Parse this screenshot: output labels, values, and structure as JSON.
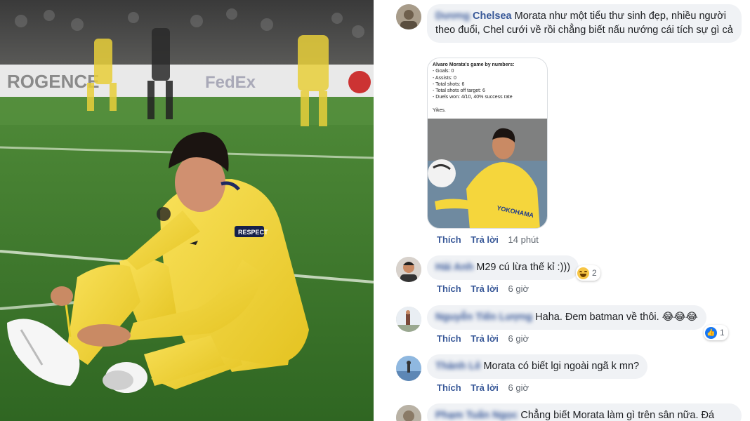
{
  "colors": {
    "link": "#385898",
    "bubble": "#f0f2f5",
    "meta": "#606770",
    "pitch": "#3f7a2c",
    "kit": "#f5d63c"
  },
  "photo": {
    "board_texts": [
      "ROGENCE",
      "FedEx"
    ],
    "armband": "RESPECT"
  },
  "comments": [
    {
      "author_blurred": "Dương",
      "author": "Chelsea",
      "text": "Morata như một tiểu thư sinh đẹp, nhiều người theo đuổi, Chel cưới về rồi chẳng biết nấu nướng cái tích sự gì cả",
      "attachment": {
        "lines": [
          "Alvaro Morata's game by numbers:",
          "- Goals: 0",
          "- Assists: 0",
          "- Total shots: 6",
          "- Total shots off target: 6",
          "- Duels won: 4/10, 40% success rate",
          "",
          "Yikes."
        ],
        "shirt_sponsor": "YOKOHAMA"
      },
      "like": "Thích",
      "reply": "Trả lời",
      "time": "14 phút"
    },
    {
      "author_blurred": "Hải Anh",
      "text": "M29 cú lừa thế kỉ :)))",
      "reaction_icon": "haha-icon",
      "reaction_count": "2",
      "like": "Thích",
      "reply": "Trả lời",
      "time": "6 giờ"
    },
    {
      "author_blurred": "Nguyễn Tiến Lượng",
      "text": "Haha. Đem batman về thôi. 😂😂😂",
      "reaction_icon": "like-icon",
      "reaction_count": "1",
      "like": "Thích",
      "reply": "Trả lời",
      "time": "6 giờ"
    },
    {
      "author_blurred": "Thành Lê",
      "text": "Morata có biết lgi ngoài ngã k mn?",
      "like": "Thích",
      "reply": "Trả lời",
      "time": "6 giờ"
    },
    {
      "author_blurred": "Phạm Tuấn Ngọc",
      "text": "Chẳng biết Morata làm gì trên sân nữa. Đá"
    }
  ]
}
